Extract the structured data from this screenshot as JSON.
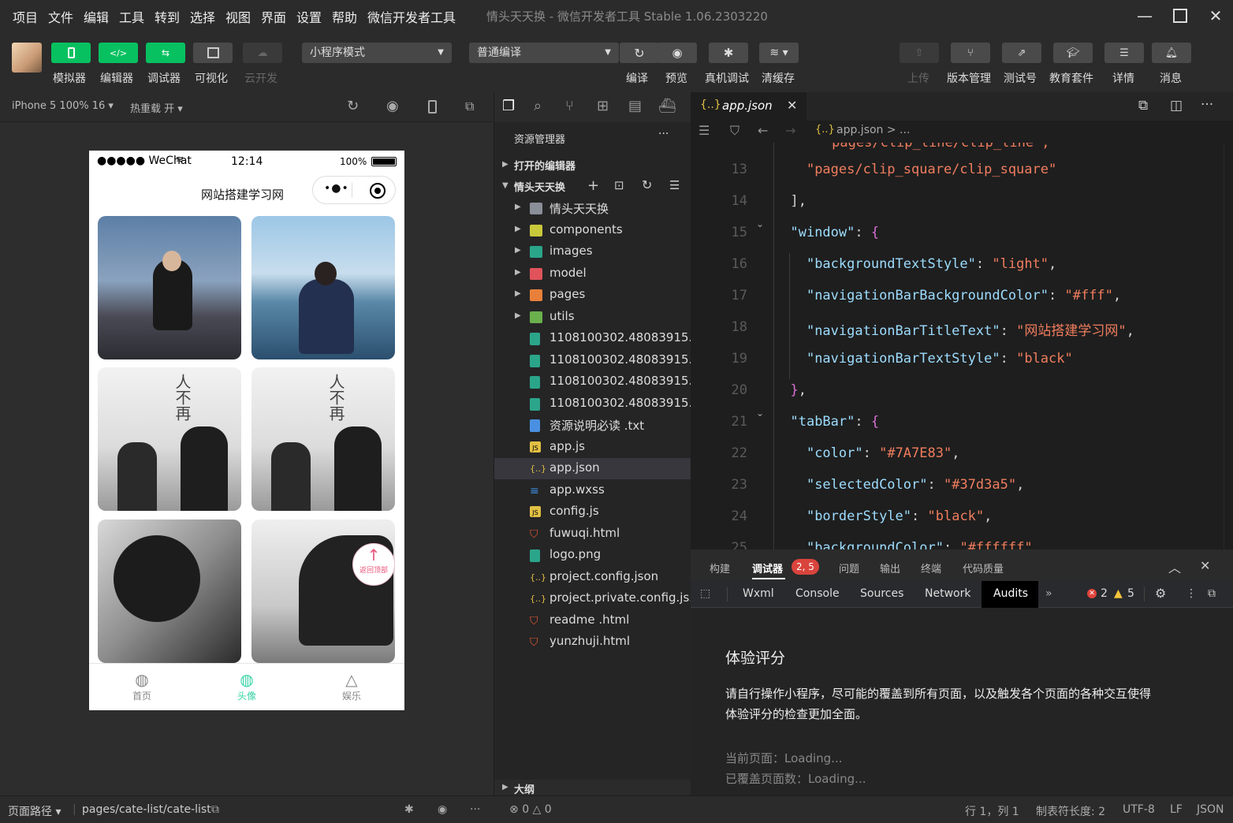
{
  "menu": [
    "项目",
    "文件",
    "编辑",
    "工具",
    "转到",
    "选择",
    "视图",
    "界面",
    "设置",
    "帮助",
    "微信开发者工具"
  ],
  "window_title": "情头天天换 - 微信开发者工具 Stable 1.06.2303220",
  "toolbar": {
    "simulator": "模拟器",
    "editor": "编辑器",
    "debugger": "调试器",
    "visual": "可视化",
    "cloud": "云开发",
    "mode_select": "小程序模式",
    "compile_select": "普通编译",
    "compile": "编译",
    "preview": "预览",
    "real_debug": "真机调试",
    "clear_cache": "清缓存",
    "upload": "上传",
    "version": "版本管理",
    "test_id": "测试号",
    "edu": "教育套件",
    "details": "详情",
    "messages": "消息"
  },
  "simbar": {
    "device": "iPhone 5 100% 16",
    "hot_reload": "热重载 开"
  },
  "phone": {
    "carrier": "●●●●● WeChat",
    "time": "12:14",
    "battery": "100%",
    "nav_title": "网站搭建学习网",
    "back_top": "返回顶部",
    "tabs": [
      {
        "label": "首页",
        "active": false
      },
      {
        "label": "头像",
        "active": true
      },
      {
        "label": "娱乐",
        "active": false
      }
    ],
    "active_color": "#37d3a5"
  },
  "sim_footer": {
    "path_label": "页面路径",
    "path": "pages/cate-list/cate-list"
  },
  "explorer": {
    "title": "资源管理器",
    "open_editors": "打开的编辑器",
    "project": "情头天天换",
    "items": [
      {
        "name": "情头天天换",
        "type": "folder",
        "color": "#8a8f99"
      },
      {
        "name": "components",
        "type": "folder",
        "color": "#c9c93c"
      },
      {
        "name": "images",
        "type": "folder",
        "color": "#2ba58a"
      },
      {
        "name": "model",
        "type": "folder",
        "color": "#e0535a"
      },
      {
        "name": "pages",
        "type": "folder",
        "color": "#e8803a"
      },
      {
        "name": "utils",
        "type": "folder",
        "color": "#6ab04c"
      },
      {
        "name": "1108100302.48083915...",
        "type": "image",
        "color": "#2ba58a"
      },
      {
        "name": "1108100302.48083915...",
        "type": "image",
        "color": "#2ba58a"
      },
      {
        "name": "1108100302.48083915...",
        "type": "image",
        "color": "#2ba58a"
      },
      {
        "name": "1108100302.48083915...",
        "type": "image",
        "color": "#2ba58a"
      },
      {
        "name": "资源说明必读 .txt",
        "type": "txt",
        "color": "#4a90e2"
      },
      {
        "name": "app.js",
        "type": "js",
        "color": "#e2c044"
      },
      {
        "name": "app.json",
        "type": "json",
        "color": "#e2c044"
      },
      {
        "name": "app.wxss",
        "type": "css",
        "color": "#3d8fe0"
      },
      {
        "name": "config.js",
        "type": "js",
        "color": "#e2c044"
      },
      {
        "name": "fuwuqi.html",
        "type": "html",
        "color": "#e4572e"
      },
      {
        "name": "logo.png",
        "type": "image",
        "color": "#2ba58a"
      },
      {
        "name": "project.config.json",
        "type": "json",
        "color": "#e2c044"
      },
      {
        "name": "project.private.config.js...",
        "type": "json",
        "color": "#e2c044"
      },
      {
        "name": "readme .html",
        "type": "html",
        "color": "#e4572e"
      },
      {
        "name": "yunzhuji.html",
        "type": "html",
        "color": "#e4572e"
      }
    ],
    "outline": "大纲"
  },
  "editor": {
    "tab": "app.json",
    "breadcrumb": "app.json > ...",
    "lines": [
      {
        "n": "13",
        "html": "    <span class='s'>\"pages/clip_square/clip_square\"</span>"
      },
      {
        "n": "14",
        "html": "  <span class='p'>],</span>"
      },
      {
        "n": "15",
        "html": "  <span class='k'>\"window\"</span><span class='p'>: </span><span class='b'>{</span>"
      },
      {
        "n": "16",
        "html": "    <span class='k'>\"backgroundTextStyle\"</span><span class='p'>: </span><span class='s'>\"light\"</span><span class='p'>,</span>"
      },
      {
        "n": "17",
        "html": "    <span class='k'>\"navigationBarBackgroundColor\"</span><span class='p'>: </span><span class='s'>\"#fff\"</span><span class='p'>,</span>"
      },
      {
        "n": "18",
        "html": "    <span class='k'>\"navigationBarTitleText\"</span><span class='p'>: </span><span class='s'>\"网站搭建学习网\"</span><span class='p'>,</span>"
      },
      {
        "n": "19",
        "html": "    <span class='k'>\"navigationBarTextStyle\"</span><span class='p'>: </span><span class='s'>\"black\"</span>"
      },
      {
        "n": "20",
        "html": "  <span class='b'>}</span><span class='p'>,</span>"
      },
      {
        "n": "21",
        "html": "  <span class='k'>\"tabBar\"</span><span class='p'>: </span><span class='b'>{</span>"
      },
      {
        "n": "22",
        "html": "    <span class='k'>\"color\"</span><span class='p'>: </span><span class='s'>\"#7A7E83\"</span><span class='p'>,</span>"
      },
      {
        "n": "23",
        "html": "    <span class='k'>\"selectedColor\"</span><span class='p'>: </span><span class='s'>\"#37d3a5\"</span><span class='p'>,</span>"
      },
      {
        "n": "24",
        "html": "    <span class='k'>\"borderStyle\"</span><span class='p'>: </span><span class='s'>\"black\"</span><span class='p'>,</span>"
      },
      {
        "n": "25",
        "html": "    <span class='k'>\"backgroundColor\"</span><span class='p'>: </span><span class='s'>\"#ffffff\"</span><span class='p'>,</span>"
      }
    ]
  },
  "debugger": {
    "tabs": [
      "构建",
      "调试器",
      "问题",
      "输出",
      "终端",
      "代码质量"
    ],
    "badge": "2, 5",
    "devtabs": [
      "Wxml",
      "Console",
      "Sources",
      "Network",
      "Audits"
    ],
    "errors": "2",
    "warnings": "5",
    "audit_title": "体验评分",
    "audit_desc_1": "请自行操作小程序，尽可能的覆盖到所有页面，以及触发各个页面的各种交互使得",
    "audit_desc_2": "体验评分的检查更加全面。",
    "current_page": "当前页面：Loading...",
    "covered_pages": "已覆盖页面数：Loading..."
  },
  "statusbar": {
    "problems_errors": "0",
    "problems_warnings": "0",
    "cursor": "行 1，列 1",
    "tab_size": "制表符长度: 2",
    "encoding": "UTF-8",
    "eol": "LF",
    "lang": "JSON"
  }
}
